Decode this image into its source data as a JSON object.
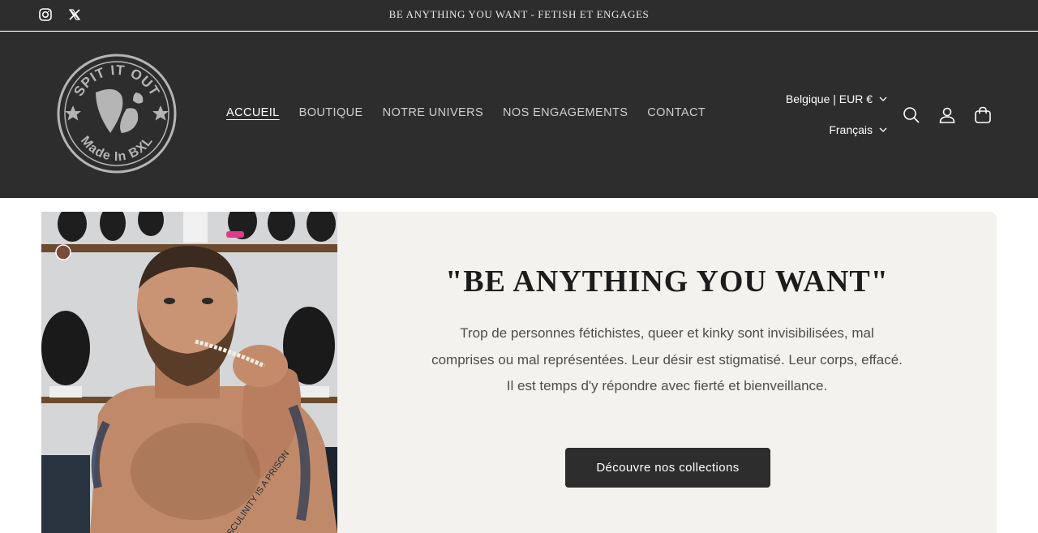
{
  "announcement": {
    "text": "BE ANYTHING YOU WANT - FETISH ET ENGAGES",
    "social_icons": [
      "instagram-icon",
      "x-twitter-icon"
    ]
  },
  "logo": {
    "top_text": "SPIT IT OUT",
    "bottom_text": "Made In BXL"
  },
  "nav": {
    "items": [
      "ACCUEIL",
      "BOUTIQUE",
      "NOTRE UNIVERS",
      "NOS ENGAGEMENTS",
      "CONTACT"
    ],
    "active": "ACCUEIL"
  },
  "localization": {
    "country": "Belgique | EUR €",
    "language": "Français"
  },
  "header_icons": [
    "search-icon",
    "account-icon",
    "cart-icon"
  ],
  "hero": {
    "title": "\"BE ANYTHING YOU WANT\"",
    "text_line1": "Trop de personnes fétichistes, queer et kinky sont invisibilisées, mal",
    "text_line2": "comprises ou mal représentées. Leur désir est stigmatisé. Leur corps, effacé.",
    "text_line3": "Il est temps d'y répondre avec fierté et bienveillance.",
    "button_label": "Découvre nos collections",
    "tattoo_text": "MASCULINITY IS A PRISON"
  },
  "colors": {
    "header_bg": "#2d2d2d",
    "panel_bg": "#f3f2ef",
    "button_bg": "#2d2d2d",
    "logo_grey": "#b5b5b5"
  }
}
